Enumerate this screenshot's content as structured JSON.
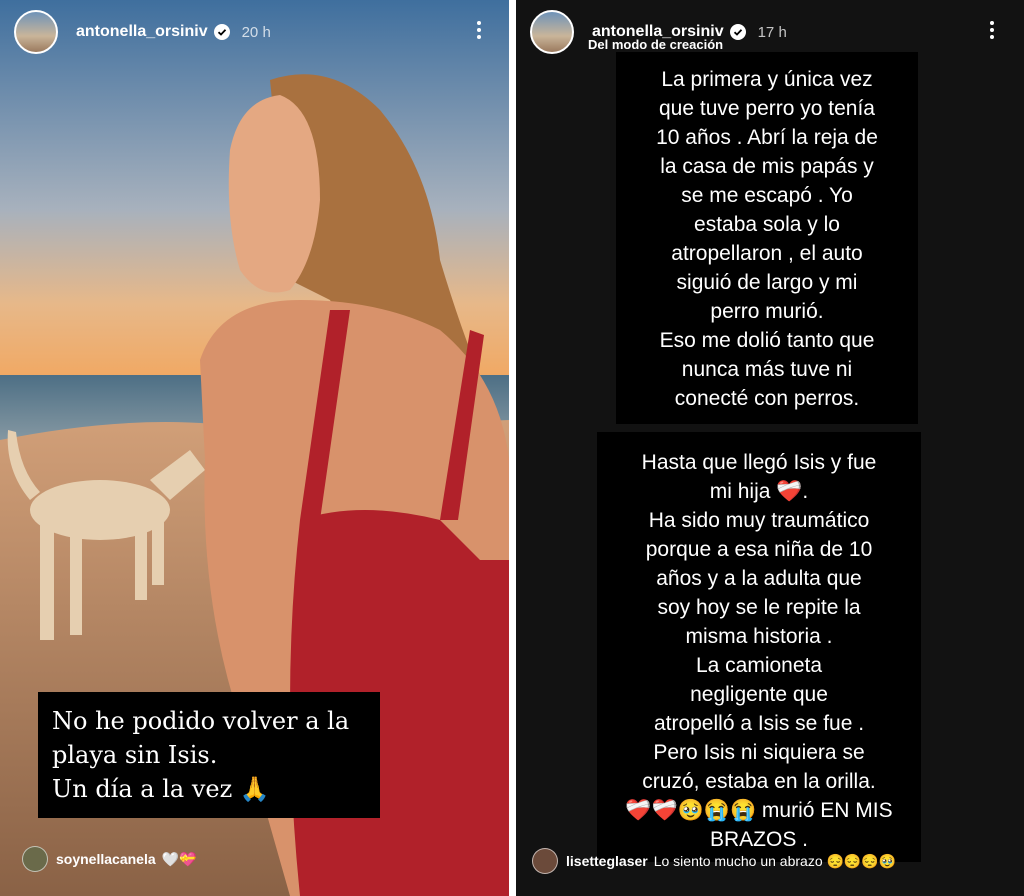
{
  "left_story": {
    "username": "antonella_orsiniv",
    "time": "20 h",
    "caption_lines": [
      "No he podido volver a la",
      "playa sin Isis.",
      "Un día a la vez 🙏"
    ],
    "mention": {
      "username": "soynellacanela",
      "emoji": "🤍💝"
    }
  },
  "right_story": {
    "username": "antonella_orsiniv",
    "time": "17 h",
    "subtitle": "Del modo de creación",
    "block_a": "La primera y única vez\nque tuve perro yo tenía\n10 años . Abrí la reja de\nla casa de mis papás y\nse me escapó .  Yo\nestaba sola y lo\natropellaron , el auto\nsiguió de largo y mi\nperro murió.\nEso me dolió tanto que\nnunca más tuve ni\nconecté con perros.",
    "block_b": "Hasta que llegó Isis y fue\nmi hija ❤️‍🩹.\nHa sido muy traumático\nporque a esa niña de 10\naños y a la adulta que\nsoy hoy se le repite la\nmisma historia .\nLa camioneta\nnegligente que\natropelló a Isis se fue .\nPero Isis ni siquiera se\ncruzó, estaba en la orilla.\n❤️‍🩹❤️‍🩹🥹😭😭 murió EN MIS\nBRAZOS .",
    "comment": {
      "username": "lisetteglaser",
      "text": "Lo siento mucho un abrazo 😔😔😔🥹"
    }
  },
  "colors": {
    "accent_verified": "#0095f6",
    "story_bg": "#121212"
  }
}
